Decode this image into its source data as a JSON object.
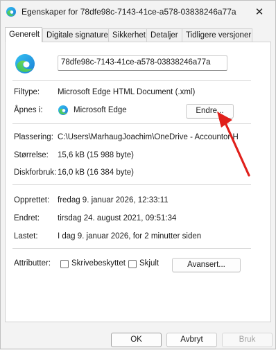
{
  "window": {
    "title": "Egenskaper for 78dfe98c-7143-41ce-a578-03838246a77a",
    "close_glyph": "✕"
  },
  "tabs": [
    {
      "label": "Generelt",
      "active": true
    },
    {
      "label": "Digitale signaturer"
    },
    {
      "label": "Sikkerhet"
    },
    {
      "label": "Detaljer"
    },
    {
      "label": "Tidligere versjoner"
    }
  ],
  "general": {
    "file_name": "78dfe98c-7143-41ce-a578-03838246a77a",
    "filetype_label": "Filtype:",
    "filetype_value": "Microsoft Edge HTML Document (.xml)",
    "opens_label": "Åpnes i:",
    "opens_value": "Microsoft Edge",
    "change_button": "Endre...",
    "location_label": "Plassering:",
    "location_value": "C:\\Users\\MarhaugJoachim\\OneDrive - Accountor H",
    "size_label": "Størrelse:",
    "size_value": "15,6 kB (15 988 byte)",
    "disk_label": "Diskforbruk:",
    "disk_value": "16,0 kB (16 384 byte)",
    "created_label": "Opprettet:",
    "created_value": "fredag 9. januar 2026, 12:33:11",
    "modified_label": "Endret:",
    "modified_value": "tirsdag 24. august 2021, 09:51:34",
    "accessed_label": "Lastet:",
    "accessed_value": "I dag 9. januar 2026, for 2 minutter siden",
    "attributes_label": "Attributter:",
    "readonly_label": "Skrivebeskyttet",
    "readonly_checked": false,
    "hidden_label": "Skjult",
    "hidden_checked": false,
    "advanced_button": "Avansert..."
  },
  "footer": {
    "ok": "OK",
    "cancel": "Avbryt",
    "apply": "Bruk"
  },
  "annotation": {
    "color": "#e0201b"
  },
  "icons": {
    "app": "edge-icon",
    "close": "close-icon",
    "annotation": "red-arrow"
  }
}
